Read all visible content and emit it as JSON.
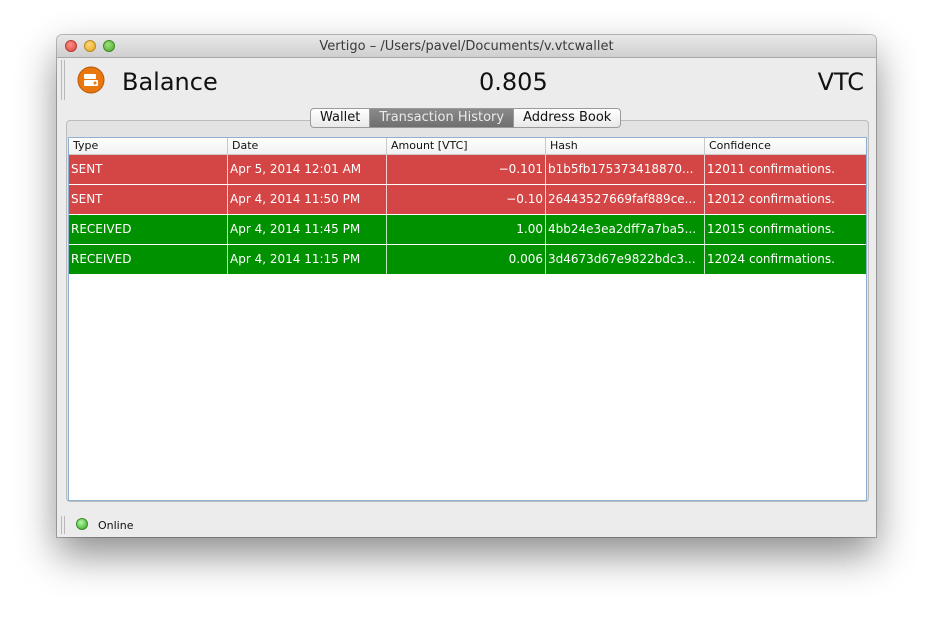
{
  "window": {
    "title": "Vertigo – /Users/pavel/Documents/v.vtcwallet"
  },
  "header": {
    "balance_label": "Balance",
    "balance_value": "0.805",
    "currency": "VTC",
    "icon": "wallet-icon"
  },
  "tabs": [
    {
      "label": "Wallet",
      "active": false
    },
    {
      "label": "Transaction History",
      "active": true
    },
    {
      "label": "Address Book",
      "active": false
    }
  ],
  "table": {
    "columns": [
      "Type",
      "Date",
      "Amount [VTC]",
      "Hash",
      "Confidence"
    ],
    "rows": [
      {
        "type": "SENT",
        "date": "Apr 5, 2014 12:01 AM",
        "amount": "−0.101",
        "hash": "b1b5fb175373418870...",
        "confidence": "12011 confirmations."
      },
      {
        "type": "SENT",
        "date": "Apr 4, 2014 11:50 PM",
        "amount": "−0.10",
        "hash": "26443527669faf889ce...",
        "confidence": "12012 confirmations."
      },
      {
        "type": "RECEIVED",
        "date": "Apr 4, 2014 11:45 PM",
        "amount": "1.00",
        "hash": "4bb24e3ea2dff7a7ba5...",
        "confidence": "12015 confirmations."
      },
      {
        "type": "RECEIVED",
        "date": "Apr 4, 2014 11:15 PM",
        "amount": "0.006",
        "hash": "3d4673d67e9822bdc3...",
        "confidence": "12024 confirmations."
      }
    ]
  },
  "status": {
    "text": "Online",
    "color": "#28a61d"
  },
  "colors": {
    "sent": "#d44545",
    "received": "#009100"
  }
}
